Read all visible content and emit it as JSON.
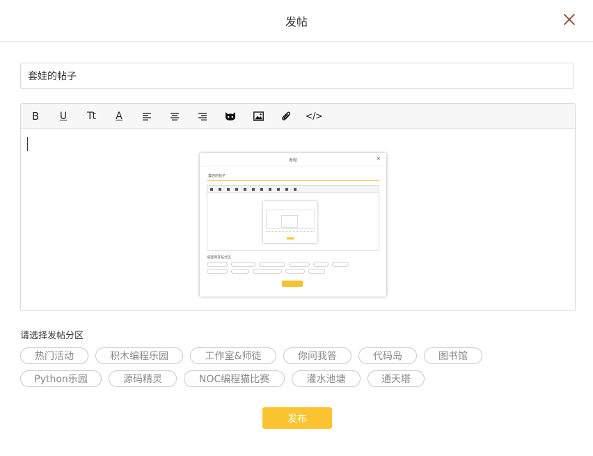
{
  "header": {
    "title": "发帖",
    "close_icon": "close-icon"
  },
  "post": {
    "title_value": "套娃的帖子"
  },
  "editor": {
    "toolbar": [
      {
        "name": "bold-icon",
        "glyph": "B"
      },
      {
        "name": "underline-icon",
        "glyph": "U"
      },
      {
        "name": "font-size-icon",
        "glyph": "Tt"
      },
      {
        "name": "font-color-icon",
        "glyph": "A"
      },
      {
        "name": "align-left-icon"
      },
      {
        "name": "align-center-icon"
      },
      {
        "name": "align-right-icon"
      },
      {
        "name": "cat-emoji-icon"
      },
      {
        "name": "image-icon"
      },
      {
        "name": "attachment-icon"
      },
      {
        "name": "code-icon",
        "glyph": "</>"
      }
    ],
    "embedded_image": {
      "inner_title": "发帖",
      "inner_close": "×",
      "inner_input": "套娃的帖子"
    }
  },
  "category": {
    "label": "请选择发帖分区",
    "tags": [
      "热门活动",
      "积木编程乐园",
      "工作室&师徒",
      "你问我答",
      "代码岛",
      "图书馆",
      "Python乐园",
      "源码精灵",
      "NOC编程猫比赛",
      "灌水池塘",
      "通天塔"
    ]
  },
  "actions": {
    "publish_label": "发布"
  },
  "colors": {
    "accent": "#fbc531",
    "close_icon": "#8a4a2e",
    "tag_border": "#c9c9c9",
    "tag_text": "#888888"
  }
}
